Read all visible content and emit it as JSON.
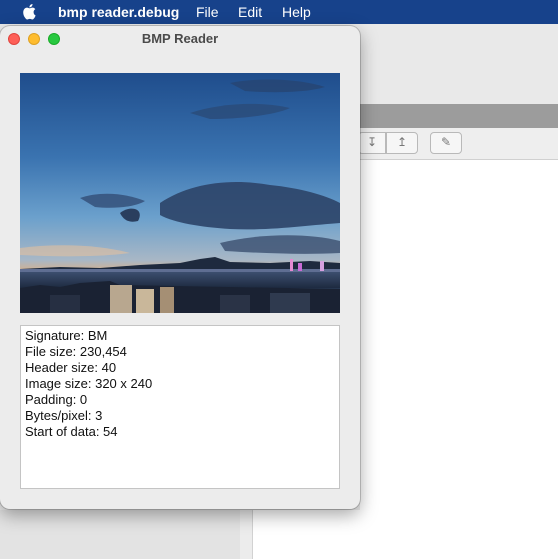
{
  "menubar": {
    "app_name": "bmp reader.debug",
    "menus": [
      "File",
      "Edit",
      "Help"
    ]
  },
  "window": {
    "title": "BMP Reader"
  },
  "image": {
    "description_icon": "image-preview"
  },
  "info": {
    "lines": [
      "Signature: BM",
      "File size: 230,454",
      "Header size: 40",
      "Image size: 320 x 240",
      "Padding: 0",
      "Bytes/pixel: 3",
      "Start of data: 54"
    ]
  },
  "colors": {
    "menubar_bg": "#17428b",
    "close": "#fe5f57",
    "minimize": "#febc2e",
    "zoom": "#28c840"
  }
}
